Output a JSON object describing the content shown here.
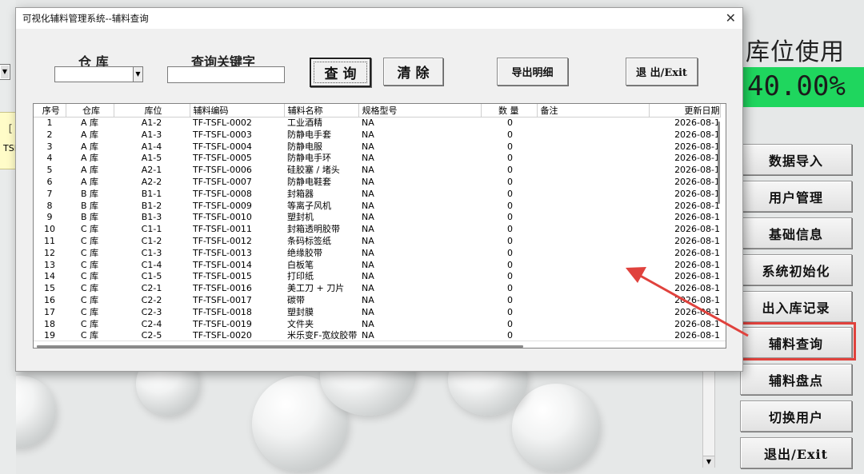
{
  "dialog": {
    "title": "可视化辅料管理系统--辅料查询",
    "close_glyph": "✕",
    "warehouse_label": "仓 库",
    "keyword_label": "查询关键字",
    "warehouse_value": "",
    "keyword_value": "",
    "buttons": {
      "query": "查 询",
      "clear": "清 除",
      "export": "导出明细",
      "exit": "退 出/Exit"
    }
  },
  "table": {
    "columns": [
      "序号",
      "仓库",
      "库位",
      "辅料编码",
      "辅料名称",
      "规格型号",
      "数 量",
      "备注",
      "更新日期"
    ],
    "rows": [
      [
        "1",
        "A 库",
        "A1-2",
        "TF-TSFL-0002",
        "工业酒精",
        "NA",
        "0",
        "",
        "2026-08-1"
      ],
      [
        "2",
        "A 库",
        "A1-3",
        "TF-TSFL-0003",
        "防静电手套",
        "NA",
        "0",
        "",
        "2026-08-1"
      ],
      [
        "3",
        "A 库",
        "A1-4",
        "TF-TSFL-0004",
        "防静电服",
        "NA",
        "0",
        "",
        "2026-08-1"
      ],
      [
        "4",
        "A 库",
        "A1-5",
        "TF-TSFL-0005",
        "防静电手环",
        "NA",
        "0",
        "",
        "2026-08-1"
      ],
      [
        "5",
        "A 库",
        "A2-1",
        "TF-TSFL-0006",
        "硅胶塞 / 堵头",
        "NA",
        "0",
        "",
        "2026-08-1"
      ],
      [
        "6",
        "A 库",
        "A2-2",
        "TF-TSFL-0007",
        "防静电鞋套",
        "NA",
        "0",
        "",
        "2026-08-1"
      ],
      [
        "7",
        "B 库",
        "B1-1",
        "TF-TSFL-0008",
        "封箱器",
        "NA",
        "0",
        "",
        "2026-08-1"
      ],
      [
        "8",
        "B 库",
        "B1-2",
        "TF-TSFL-0009",
        "等离子风机",
        "NA",
        "0",
        "",
        "2026-08-1"
      ],
      [
        "9",
        "B 库",
        "B1-3",
        "TF-TSFL-0010",
        "塑封机",
        "NA",
        "0",
        "",
        "2026-08-1"
      ],
      [
        "10",
        "C 库",
        "C1-1",
        "TF-TSFL-0011",
        "封箱透明胶带",
        "NA",
        "0",
        "",
        "2026-08-1"
      ],
      [
        "11",
        "C 库",
        "C1-2",
        "TF-TSFL-0012",
        "条码标签纸",
        "NA",
        "0",
        "",
        "2026-08-1"
      ],
      [
        "12",
        "C 库",
        "C1-3",
        "TF-TSFL-0013",
        "绝缘胶带",
        "NA",
        "0",
        "",
        "2026-08-1"
      ],
      [
        "13",
        "C 库",
        "C1-4",
        "TF-TSFL-0014",
        "白板笔",
        "NA",
        "0",
        "",
        "2026-08-1"
      ],
      [
        "14",
        "C 库",
        "C1-5",
        "TF-TSFL-0015",
        "打印纸",
        "NA",
        "0",
        "",
        "2026-08-1"
      ],
      [
        "15",
        "C 库",
        "C2-1",
        "TF-TSFL-0016",
        "美工刀 + 刀片",
        "NA",
        "0",
        "",
        "2026-08-1"
      ],
      [
        "16",
        "C 库",
        "C2-2",
        "TF-TSFL-0017",
        "碳带",
        "NA",
        "0",
        "",
        "2026-08-1"
      ],
      [
        "17",
        "C 库",
        "C2-3",
        "TF-TSFL-0018",
        "塑封膜",
        "NA",
        "0",
        "",
        "2026-08-1"
      ],
      [
        "18",
        "C 库",
        "C2-4",
        "TF-TSFL-0019",
        "文件夹",
        "NA",
        "0",
        "",
        "2026-08-1"
      ],
      [
        "19",
        "C 库",
        "C2-5",
        "TF-TSFL-0020",
        "米乐变F-宽纹胶带",
        "NA",
        "0",
        "",
        "2026-08-1"
      ]
    ]
  },
  "right_panel": {
    "usage_title": "库位使用",
    "usage_value": "40.00%",
    "buttons": [
      "数据导入",
      "用户管理",
      "基础信息",
      "系统初始化",
      "出入库记录",
      "辅料查询",
      "辅料盘点",
      "切换用户",
      "退出/Exit"
    ]
  },
  "background": {
    "left_text_1": "［",
    "left_text_2": "TSF"
  },
  "colors": {
    "usage_green": "#1fd65e",
    "highlight_red": "#e0423d"
  }
}
